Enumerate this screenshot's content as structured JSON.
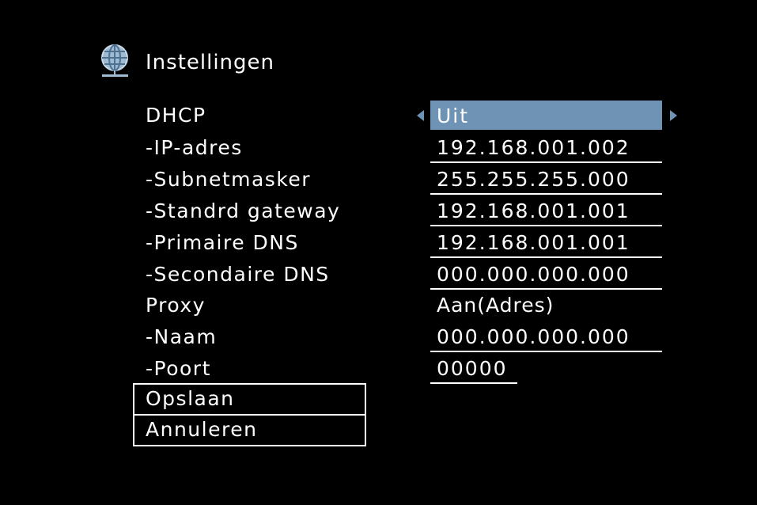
{
  "header": {
    "icon": "globe-icon",
    "title": "Instellingen"
  },
  "colors": {
    "background": "#000000",
    "text": "#ffffff",
    "highlight": "#6e93b4"
  },
  "settings": {
    "dhcp": {
      "label": "DHCP",
      "value": "Uit"
    },
    "ip_address": {
      "label": "-IP-adres",
      "value": "192.168.001.002"
    },
    "subnet_mask": {
      "label": "-Subnetmasker",
      "value": "255.255.255.000"
    },
    "default_gateway": {
      "label": "-Standrd gateway",
      "value": "192.168.001.001"
    },
    "primary_dns": {
      "label": "-Primaire DNS",
      "value": "192.168.001.001"
    },
    "secondary_dns": {
      "label": "-Secondaire DNS",
      "value": "000.000.000.000"
    },
    "proxy": {
      "label": "Proxy",
      "value": "Aan(Adres)"
    },
    "proxy_name": {
      "label": "-Naam",
      "value": "000.000.000.000"
    },
    "proxy_port": {
      "label": "-Poort",
      "value": "00000"
    }
  },
  "actions": {
    "save_label": "Opslaan",
    "cancel_label": "Annuleren"
  }
}
